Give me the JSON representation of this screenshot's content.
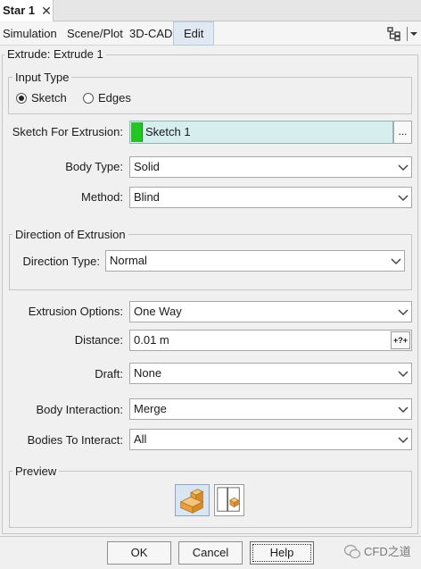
{
  "tab": {
    "title": "Star 1",
    "close": "✕"
  },
  "menu": {
    "items": [
      "Simulation",
      "Scene/Plot",
      "3D-CAD",
      "Edit"
    ]
  },
  "panel": {
    "title": "Extrude: Extrude 1",
    "input_type": {
      "legend": "Input Type",
      "options": [
        "Sketch",
        "Edges"
      ],
      "selected": "Sketch"
    },
    "sketch_for_extrusion": {
      "label": "Sketch For Extrusion:",
      "value": "Sketch 1",
      "browse": "...",
      "swatch_color": "#1ec81e"
    },
    "body_type": {
      "label": "Body Type:",
      "value": "Solid"
    },
    "method": {
      "label": "Method:",
      "value": "Blind"
    },
    "direction": {
      "legend": "Direction of Extrusion",
      "label": "Direction Type:",
      "value": "Normal"
    },
    "extrusion_options": {
      "label": "Extrusion Options:",
      "value": "One Way"
    },
    "distance": {
      "label": "Distance:",
      "value": "0.01 m",
      "unit_button": "+?+"
    },
    "draft": {
      "label": "Draft:",
      "value": "None"
    },
    "body_interaction": {
      "label": "Body Interaction:",
      "value": "Merge"
    },
    "bodies_to_interact": {
      "label": "Bodies To Interact:",
      "value": "All"
    },
    "preview": {
      "legend": "Preview"
    }
  },
  "buttons": {
    "ok": "OK",
    "cancel": "Cancel",
    "help": "Help"
  },
  "watermark": "CFD之道",
  "colors": {
    "accent_edit": "#dfe8f3",
    "sketch_field": "#d6eeee",
    "icon_orange": "#f2a640"
  }
}
